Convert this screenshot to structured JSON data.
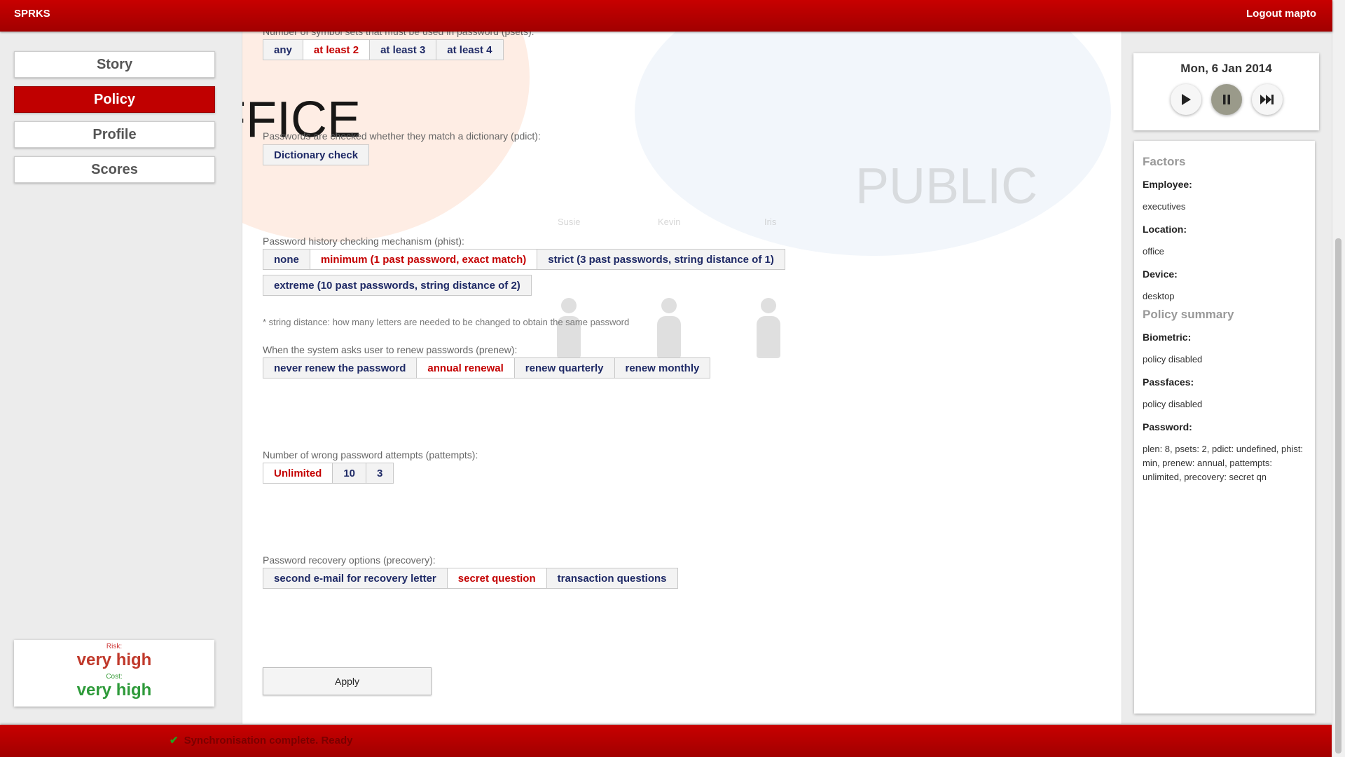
{
  "header": {
    "brand": "SPRKS",
    "logout": "Logout mapto"
  },
  "nav": {
    "items": [
      "Story",
      "Policy",
      "Profile",
      "Scores"
    ],
    "active": "Policy"
  },
  "summary": {
    "risk_label": "Risk:",
    "risk_value": "very high",
    "cost_label": "Cost:",
    "cost_value": "very high"
  },
  "background": {
    "office": "OFFICE",
    "public": "PUBLIC",
    "people": [
      "Susie",
      "Kevin",
      "Iris"
    ]
  },
  "policy": {
    "psets": {
      "label": "Number of symbol sets that must be used in password (psets):",
      "options": [
        "any",
        "at least 2",
        "at least 3",
        "at least 4"
      ],
      "selected": "at least 2"
    },
    "pdict": {
      "label": "Passwords are checked whether they match a dictionary (pdict):",
      "options": [
        "Dictionary check"
      ]
    },
    "phist": {
      "label": "Password history checking mechanism (phist):",
      "options": [
        "none",
        "minimum (1 past password, exact match)",
        "strict (3 past passwords, string distance of 1)",
        "extreme (10 past passwords, string distance of 2)"
      ],
      "selected": "minimum (1 past password, exact match)",
      "note": "* string distance: how many letters are needed to be changed to obtain the same password"
    },
    "prenew": {
      "label": "When the system asks user to renew passwords (prenew):",
      "options": [
        "never renew the password",
        "annual renewal",
        "renew quarterly",
        "renew monthly"
      ],
      "selected": "annual renewal"
    },
    "pattempts": {
      "label": "Number of wrong password attempts (pattempts):",
      "options": [
        "Unlimited",
        "10",
        "3"
      ],
      "selected": "Unlimited"
    },
    "precovery": {
      "label": "Password recovery options (precovery):",
      "options": [
        "second e-mail for recovery letter",
        "secret question",
        "transaction questions"
      ],
      "selected": "secret question"
    },
    "apply": "Apply"
  },
  "controls": {
    "date": "Mon, 6 Jan 2014",
    "icons": [
      "play-icon",
      "pause-icon",
      "fast-forward-icon"
    ]
  },
  "side": {
    "factors_title": "Factors",
    "employee_key": "Employee:",
    "employee_val": "executives",
    "location_key": "Location:",
    "location_val": "office",
    "device_key": "Device:",
    "device_val": "desktop",
    "policy_title": "Policy summary",
    "biometric_key": "Biometric:",
    "biometric_val": "policy disabled",
    "passfaces_key": "Passfaces:",
    "passfaces_val": "policy disabled",
    "password_key": "Password:",
    "password_val": "plen: 8, psets: 2, pdict: undefined, phist: min, prenew: annual, pattempts: unlimited, precovery: secret qn"
  },
  "status": {
    "text": "Synchronisation complete. Ready"
  },
  "colors": {
    "brand_red": "#b40000",
    "selected_option": "#c40000",
    "option_text": "#1f2a66",
    "risk": "#c0392b",
    "cost": "#2e9a3a"
  }
}
